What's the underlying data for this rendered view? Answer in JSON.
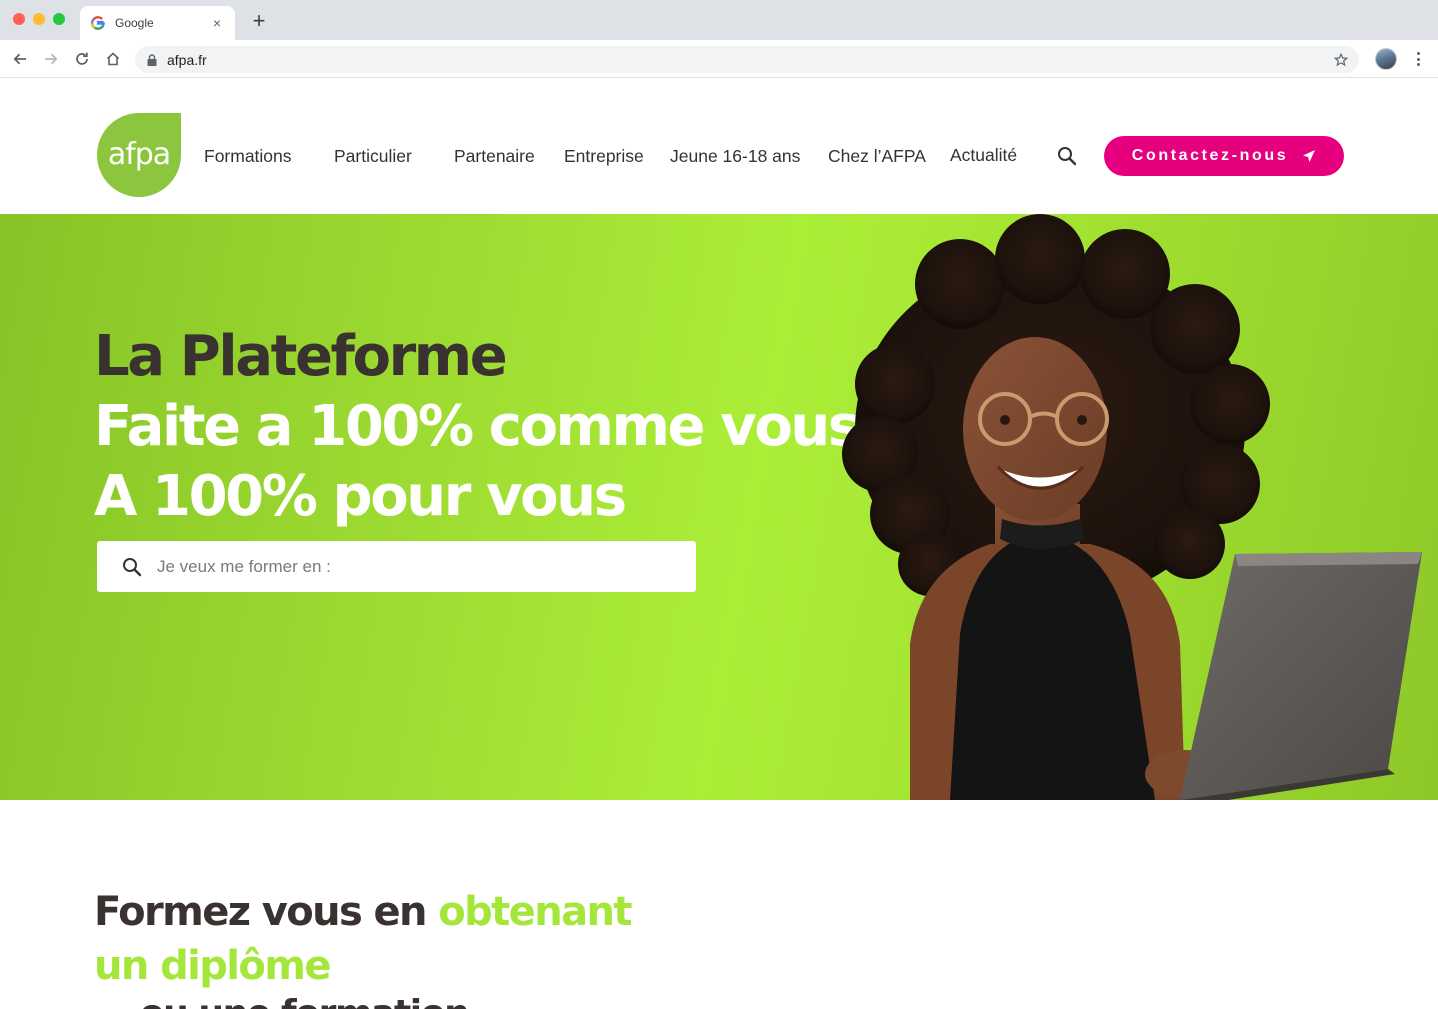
{
  "browser": {
    "tab_title": "Google",
    "tab_close": "×",
    "new_tab": "+",
    "url": "afpa.fr"
  },
  "header": {
    "logo_text": "afpa",
    "nav": [
      "Formations",
      "Particulier",
      "Partenaire",
      "Entreprise",
      "Jeune 16-18 ans",
      "Chez l’AFPA",
      "Actualité"
    ],
    "contact_label": "Contactez-nous"
  },
  "hero": {
    "title_line1": "La Plateforme",
    "title_line2": "Faite a 100% comme vous",
    "title_line3": "A 100% pour vous",
    "search_placeholder": "Je veux me former en :"
  },
  "section": {
    "title_dark": "Formez vous en ",
    "title_green_1": "obtenant",
    "title_green_2": "un diplôme",
    "subtitle_partial": "… ou une formation"
  },
  "colors": {
    "brand_green": "#8cc63f",
    "hero_green": "#abee38",
    "accent_pink": "#e6007e",
    "text_dark": "#3a3131",
    "highlight_green": "#a4e63a"
  },
  "icons": {
    "favicon": "google-g-icon",
    "back": "arrow-left-icon",
    "forward": "arrow-right-icon",
    "reload": "reload-icon",
    "home": "home-icon",
    "lock": "lock-icon",
    "bookmark": "star-icon",
    "menu": "kebab-menu-icon",
    "search": "search-icon",
    "send": "paper-plane-icon"
  }
}
